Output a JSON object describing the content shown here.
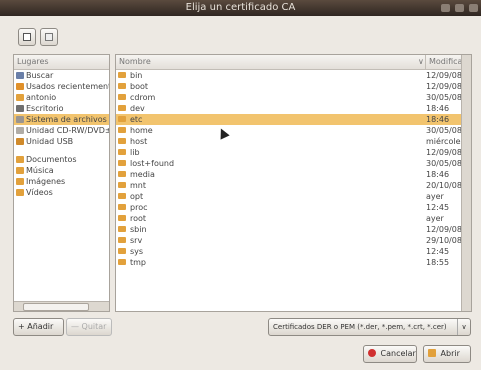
{
  "window": {
    "title": "Elija un certificado CA"
  },
  "colors": {
    "selection": "#f2c46e",
    "folder": "#e2a13c"
  },
  "places": {
    "header": "Lugares",
    "items": [
      {
        "label": "Buscar",
        "icon": "search-icon"
      },
      {
        "label": "Usados recientemente",
        "icon": "recent-icon"
      },
      {
        "label": "antonio",
        "icon": "home-folder-icon"
      },
      {
        "label": "Escritorio",
        "icon": "desktop-icon"
      },
      {
        "label": "Sistema de archivos",
        "icon": "drive-icon",
        "selected": true
      },
      {
        "label": "Unidad CD-RW/DVD±",
        "icon": "cdrom-icon"
      },
      {
        "label": "Unidad USB",
        "icon": "usb-icon"
      }
    ],
    "bookmarks": [
      {
        "label": "Documentos",
        "icon": "folder-icon"
      },
      {
        "label": "Música",
        "icon": "folder-icon"
      },
      {
        "label": "Imágenes",
        "icon": "folder-icon"
      },
      {
        "label": "Vídeos",
        "icon": "folder-icon"
      }
    ]
  },
  "files": {
    "col_name": "Nombre",
    "col_modified": "Modificado",
    "rows": [
      {
        "name": "bin",
        "modified": "12/09/08"
      },
      {
        "name": "boot",
        "modified": "12/09/08"
      },
      {
        "name": "cdrom",
        "modified": "30/05/08"
      },
      {
        "name": "dev",
        "modified": "18:46"
      },
      {
        "name": "etc",
        "modified": "18:46",
        "selected": true
      },
      {
        "name": "home",
        "modified": "30/05/08"
      },
      {
        "name": "host",
        "modified": "miércoles"
      },
      {
        "name": "lib",
        "modified": "12/09/08"
      },
      {
        "name": "lost+found",
        "modified": "30/05/08"
      },
      {
        "name": "media",
        "modified": "18:46"
      },
      {
        "name": "mnt",
        "modified": "20/10/08"
      },
      {
        "name": "opt",
        "modified": "ayer"
      },
      {
        "name": "proc",
        "modified": "12:45"
      },
      {
        "name": "root",
        "modified": "ayer"
      },
      {
        "name": "sbin",
        "modified": "12/09/08"
      },
      {
        "name": "srv",
        "modified": "29/10/08"
      },
      {
        "name": "sys",
        "modified": "12:45"
      },
      {
        "name": "tmp",
        "modified": "18:55"
      }
    ]
  },
  "buttons": {
    "add": "Añadir",
    "remove": "Quitar",
    "cancel": "Cancelar",
    "open": "Abrir"
  },
  "filter": {
    "selected": "Certificados DER o PEM (*.der, *.pem, *.crt, *.cer)"
  }
}
